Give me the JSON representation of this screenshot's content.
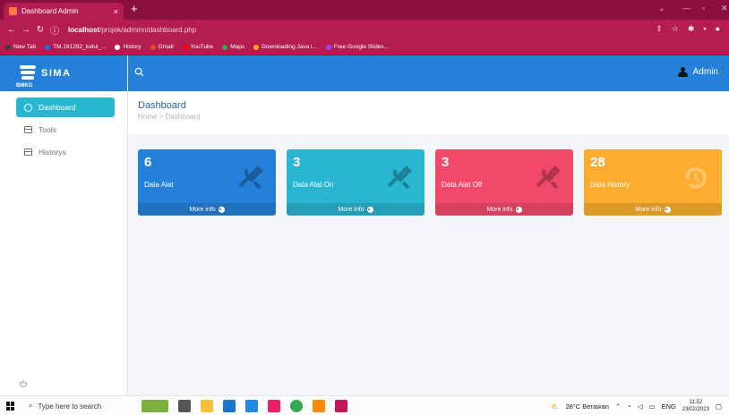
{
  "browser": {
    "tab_title": "Dashboard Admin",
    "tab_close": "×",
    "new_tab": "+",
    "url_host": "localhost",
    "url_path": "/projek/adminn/dashboard.php",
    "bookmarks": [
      {
        "label": "New Tab",
        "color": "#3c4043"
      },
      {
        "label": "TM.161292_ludul_...",
        "color": "#1a73e8"
      },
      {
        "label": "History",
        "color": "#ffffff"
      },
      {
        "label": "Gmail",
        "color": "#ea4335"
      },
      {
        "label": "YouTube",
        "color": "#ff0000"
      },
      {
        "label": "Maps",
        "color": "#34a853"
      },
      {
        "label": "Downloading Java i...",
        "color": "#f9ab00"
      },
      {
        "label": "Free Google Slides...",
        "color": "#a142f4"
      }
    ]
  },
  "brand": {
    "name": "SIMA",
    "sub": "BMKG"
  },
  "sidebar": {
    "items": [
      {
        "label": "Dashboard",
        "active": true
      },
      {
        "label": "Tools",
        "active": false
      },
      {
        "label": "Historys",
        "active": false
      }
    ]
  },
  "topnav": {
    "user": "Admin"
  },
  "header": {
    "title": "Dashboard",
    "crumb_home": "Home",
    "crumb_sep": ">",
    "crumb_current": "Dashboard"
  },
  "cards": [
    {
      "value": "6",
      "label": "Data Alat",
      "more": "More info",
      "color": "#2580d9",
      "icon": "tools-icon"
    },
    {
      "value": "3",
      "label": "Data Alat On",
      "more": "More info",
      "color": "#29b6d1",
      "icon": "tools-icon"
    },
    {
      "value": "3",
      "label": "Data Alat Off",
      "more": "More info",
      "color": "#f2496a",
      "icon": "tools-icon"
    },
    {
      "value": "28",
      "label": "Data History",
      "more": "More info",
      "color": "#fcad30",
      "icon": "history-icon"
    }
  ],
  "taskbar": {
    "search_placeholder": "Type here to search",
    "weather": "28°C Berawan",
    "lang": "ENG",
    "time": "11:52",
    "date": "23/02/2023"
  }
}
